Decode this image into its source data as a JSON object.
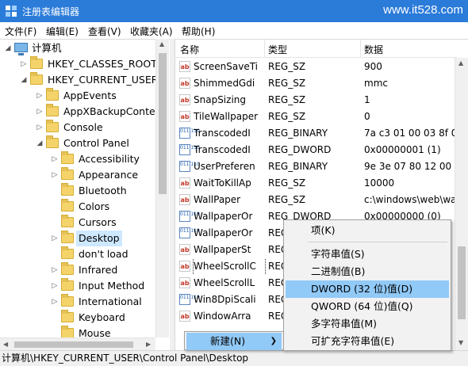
{
  "window": {
    "title": "注册表编辑器",
    "watermark": "www.it528.com"
  },
  "menubar": [
    {
      "label": "文件(F)"
    },
    {
      "label": "编辑(E)"
    },
    {
      "label": "查看(V)"
    },
    {
      "label": "收藏夹(A)"
    },
    {
      "label": "帮助(H)"
    }
  ],
  "tree": {
    "root": "计算机",
    "nodes": [
      {
        "label": "HKEY_CLASSES_ROOT",
        "state": "collapsed"
      },
      {
        "label": "HKEY_CURRENT_USER",
        "state": "expanded"
      },
      {
        "label": "AppEvents",
        "state": "collapsed"
      },
      {
        "label": "AppXBackupConter",
        "state": "collapsed"
      },
      {
        "label": "Console",
        "state": "collapsed"
      },
      {
        "label": "Control Panel",
        "state": "expanded"
      },
      {
        "label": "Accessibility",
        "state": "collapsed"
      },
      {
        "label": "Appearance",
        "state": "collapsed"
      },
      {
        "label": "Bluetooth",
        "state": "none"
      },
      {
        "label": "Colors",
        "state": "none"
      },
      {
        "label": "Cursors",
        "state": "none"
      },
      {
        "label": "Desktop",
        "state": "collapsed",
        "selected": true
      },
      {
        "label": "don't load",
        "state": "none"
      },
      {
        "label": "Infrared",
        "state": "collapsed"
      },
      {
        "label": "Input Method",
        "state": "collapsed"
      },
      {
        "label": "International",
        "state": "collapsed"
      },
      {
        "label": "Keyboard",
        "state": "none"
      },
      {
        "label": "Mouse",
        "state": "none"
      }
    ]
  },
  "list": {
    "headers": [
      "名称",
      "类型",
      "数据"
    ],
    "rows": [
      {
        "icon": "string-value-icon",
        "name": "ScreenSaveTi",
        "type": "REG_SZ",
        "data": "900"
      },
      {
        "icon": "string-value-icon",
        "name": "ShimmedGdi",
        "type": "REG_SZ",
        "data": "mmc"
      },
      {
        "icon": "string-value-icon",
        "name": "SnapSizing",
        "type": "REG_SZ",
        "data": "1"
      },
      {
        "icon": "string-value-icon",
        "name": "TileWallpaper",
        "type": "REG_SZ",
        "data": "0"
      },
      {
        "icon": "binary-value-icon",
        "name": "TranscodedI",
        "type": "REG_BINARY",
        "data": "7a c3 01 00 03 8f 0"
      },
      {
        "icon": "binary-value-icon",
        "name": "TranscodedI",
        "type": "REG_DWORD",
        "data": "0x00000001 (1)"
      },
      {
        "icon": "binary-value-icon",
        "name": "UserPreferen",
        "type": "REG_BINARY",
        "data": "9e 3e 07 80 12 00 0"
      },
      {
        "icon": "string-value-icon",
        "name": "WaitToKillAp",
        "type": "REG_SZ",
        "data": "10000"
      },
      {
        "icon": "string-value-icon",
        "name": "WallPaper",
        "type": "REG_SZ",
        "data": "c:\\windows\\web\\wa"
      },
      {
        "icon": "binary-value-icon",
        "name": "WallpaperOr",
        "type": "REG_DWORD",
        "data": "0x00000000 (0)"
      },
      {
        "icon": "binary-value-icon",
        "name": "WallpaperOr",
        "type": "REG",
        "data": ""
      },
      {
        "icon": "string-value-icon",
        "name": "WallpaperSt",
        "type": "REG",
        "data": ""
      },
      {
        "icon": "string-value-icon",
        "name": "WheelScrollC",
        "type": "REG",
        "data": ""
      },
      {
        "icon": "string-value-icon",
        "name": "WheelScrollL",
        "type": "REG",
        "data": ""
      },
      {
        "icon": "binary-value-icon",
        "name": "Win8DpiScali",
        "type": "REG",
        "data": ""
      },
      {
        "icon": "string-value-icon",
        "name": "WindowArra",
        "type": "REG",
        "data": ""
      }
    ]
  },
  "context_menu": {
    "new_label": "新建(N)",
    "submenu": [
      {
        "label": "项(K)"
      },
      {
        "label": "字符串值(S)"
      },
      {
        "label": "二进制值(B)"
      },
      {
        "label": "DWORD (32 位)值(D)",
        "highlighted": true
      },
      {
        "label": "QWORD (64 位)值(Q)"
      },
      {
        "label": "多字符串值(M)"
      },
      {
        "label": "可扩充字符串值(E)"
      }
    ]
  },
  "status": {
    "path": "计算机\\HKEY_CURRENT_USER\\Control Panel\\Desktop"
  },
  "colors": {
    "titlebar": "#2b7bd9",
    "selection": "#cde8ff",
    "menu_highlight": "#91c9f7"
  }
}
